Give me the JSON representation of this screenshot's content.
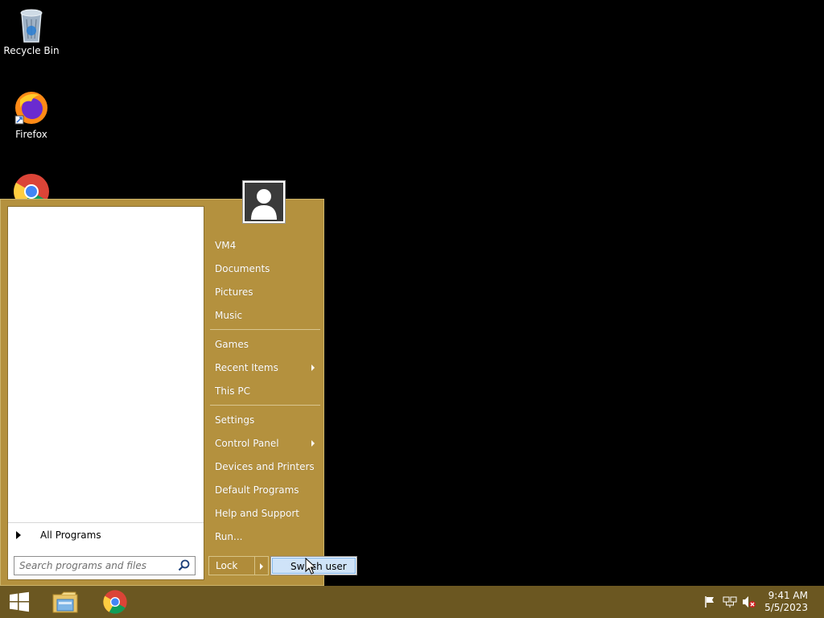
{
  "desktop": {
    "icons": [
      {
        "label": "Recycle Bin",
        "icon": "recycle-bin-icon"
      },
      {
        "label": "Firefox",
        "icon": "firefox-icon"
      },
      {
        "label": "",
        "icon": "chrome-icon"
      }
    ]
  },
  "start_menu": {
    "all_programs": "All Programs",
    "search": {
      "placeholder": "Search programs and files",
      "value": ""
    },
    "user_picture": "user-avatar-icon",
    "right_items": [
      {
        "label": "VM4",
        "submenu": false
      },
      {
        "label": "Documents",
        "submenu": false
      },
      {
        "label": "Pictures",
        "submenu": false
      },
      {
        "label": "Music",
        "submenu": false
      },
      {
        "label": "Games",
        "submenu": false
      },
      {
        "label": "Recent Items",
        "submenu": true
      },
      {
        "label": "This PC",
        "submenu": false
      },
      {
        "label": "Settings",
        "submenu": false
      },
      {
        "label": "Control Panel",
        "submenu": true
      },
      {
        "label": "Devices and Printers",
        "submenu": false
      },
      {
        "label": "Default Programs",
        "submenu": false
      },
      {
        "label": "Help and Support",
        "submenu": false
      },
      {
        "label": "Run...",
        "submenu": false
      }
    ],
    "lock_label": "Lock",
    "power_submenu": {
      "items": [
        "Switch user"
      ],
      "highlighted": "Switch user"
    }
  },
  "taskbar": {
    "pinned": [
      "windows-start-icon",
      "file-explorer-icon",
      "chrome-icon"
    ],
    "tray_icons": [
      "flag-icon",
      "network-icon",
      "volume-muted-icon"
    ],
    "time": "9:41 AM",
    "date": "5/5/2023"
  },
  "colors": {
    "menu_bg": "#b4913e",
    "taskbar_bg": "#6b5721",
    "highlight": "#cfe3f8"
  }
}
